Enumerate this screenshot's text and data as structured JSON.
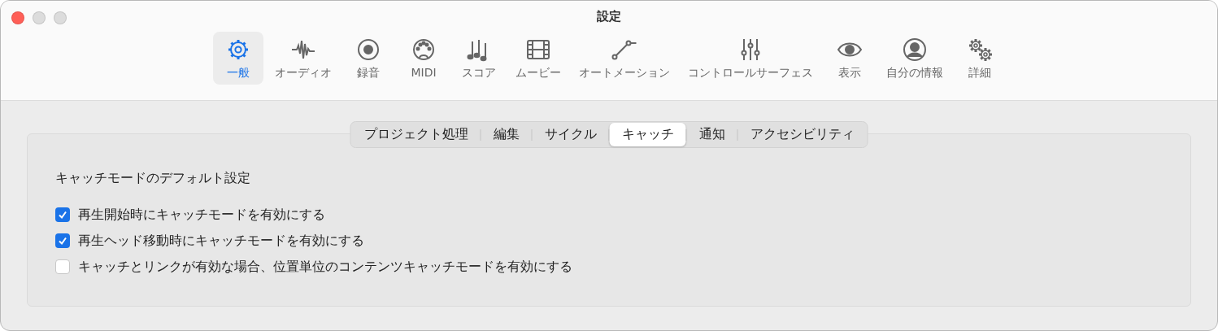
{
  "window": {
    "title": "設定"
  },
  "toolbar": [
    {
      "label": "一般",
      "selected": true
    },
    {
      "label": "オーディオ",
      "selected": false
    },
    {
      "label": "録音",
      "selected": false
    },
    {
      "label": "MIDI",
      "selected": false
    },
    {
      "label": "スコア",
      "selected": false
    },
    {
      "label": "ムービー",
      "selected": false
    },
    {
      "label": "オートメーション",
      "selected": false
    },
    {
      "label": "コントロールサーフェス",
      "selected": false
    },
    {
      "label": "表示",
      "selected": false
    },
    {
      "label": "自分の情報",
      "selected": false
    },
    {
      "label": "詳細",
      "selected": false
    }
  ],
  "tabs": [
    {
      "label": "プロジェクト処理",
      "selected": false
    },
    {
      "label": "編集",
      "selected": false
    },
    {
      "label": "サイクル",
      "selected": false
    },
    {
      "label": "キャッチ",
      "selected": true
    },
    {
      "label": "通知",
      "selected": false
    },
    {
      "label": "アクセシビリティ",
      "selected": false
    }
  ],
  "section": {
    "heading": "キャッチモードのデフォルト設定",
    "options": [
      {
        "label": "再生開始時にキャッチモードを有効にする",
        "checked": true
      },
      {
        "label": "再生ヘッド移動時にキャッチモードを有効にする",
        "checked": true
      },
      {
        "label": "キャッチとリンクが有効な場合、位置単位のコンテンツキャッチモードを有効にする",
        "checked": false
      }
    ]
  }
}
